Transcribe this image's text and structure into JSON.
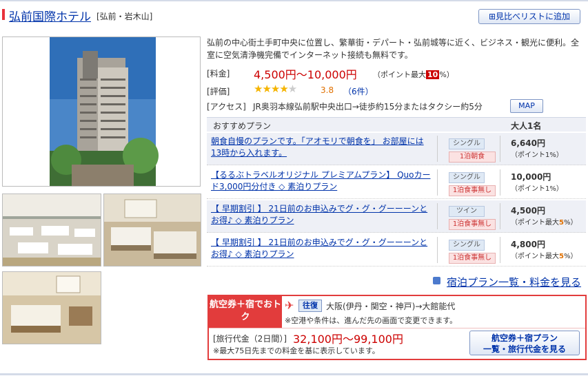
{
  "hotel": {
    "name": "弘前国際ホテル",
    "area": "[弘前・岩木山]",
    "compare_label": "⊞見比べリストに追加",
    "description": "弘前の中心街土手町中央に位置し、繁華街・デパート・弘前城等に近く、ビジネス・観光に便利。全室に空気清浄機完備でインターネット接続も無料です。",
    "price_label": "[料金]",
    "price": "4,500円～10,000円",
    "point_prefix": "（ポイント最大",
    "point_value": "10",
    "point_suffix": "%）",
    "rating_label": "[評価]",
    "stars_filled": "★★★★",
    "stars_empty": "★",
    "score": "3.8",
    "reviews": "（6件）",
    "access_label": "[アクセス]",
    "access": "JR奥羽本線弘前駅中央出口→徒歩約15分またはタクシー約5分",
    "map_label": "MAP"
  },
  "plans": {
    "header_plan": "おすすめプラン",
    "header_price": "大人1名",
    "rows": [
      {
        "name": "朝食自慢のプランです。「アオモリで朝食を」 お部屋には13時から入れます。",
        "room": "シングル",
        "meal": "1泊朝食",
        "price": "6,640円",
        "point": "（ポイント1%）",
        "point_num": ""
      },
      {
        "name": "【るるぶトラベルオリジナル プレミアムプラン】 Quoカード3,000円分付き ◇ 素泊りプラン",
        "room": "シングル",
        "meal": "1泊食事無し",
        "price": "10,000円",
        "point": "（ポイント1%）",
        "point_num": ""
      },
      {
        "name": "【 早期割引 】 21日前のお申込みでグ・グ・グーーーンとお得♪ ◇ 素泊りプラン",
        "room": "ツイン",
        "meal": "1泊食事無し",
        "price": "4,500円",
        "point": "（ポイント最大",
        "point_num": "5"
      },
      {
        "name": "【 早期割引 】 21日前のお申込みでグ・グ・グーーーンとお得♪ ◇ 素泊りプラン",
        "room": "シングル",
        "meal": "1泊食事無し",
        "price": "4,800円",
        "point": "（ポイント最大",
        "point_num": "5"
      }
    ],
    "point_suffix": "%）",
    "more_label": "宿泊プラン一覧・料金を見る"
  },
  "flight": {
    "tag": "航空券＋宿でおトク",
    "round_label": "往復",
    "route": "大阪(伊丹・関空・神戸)→大館能代",
    "note1": "※空港や条件は、進んだ先の画面で変更できます。",
    "price_label": "[旅行代金（2日間）]",
    "price": "32,100円～99,100円",
    "note2": "※最大75日先までの料金を基に表示しています。",
    "button_line1": "航空券＋宿プラン",
    "button_line2": "一覧・旅行代金を見る"
  },
  "colors": {
    "accent_red": "#e23c3c",
    "link": "#0033aa",
    "price": "#cc0000"
  }
}
